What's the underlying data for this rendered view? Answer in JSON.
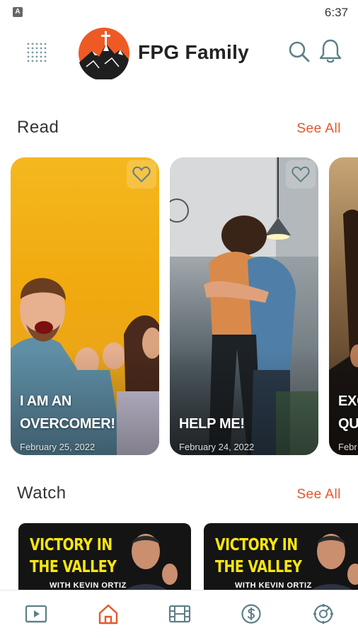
{
  "status_bar": {
    "time": "6:37",
    "indicator": "A"
  },
  "header": {
    "app_name": "FPG Family",
    "icons": [
      "grid-menu-icon",
      "search-icon",
      "bell-icon"
    ]
  },
  "read": {
    "title": "Read",
    "see_all": "See All",
    "cards": [
      {
        "title_line1": "I AM AN",
        "title_line2": "OVERCOMER!",
        "date": "February 25, 2022"
      },
      {
        "title_line1": "HELP ME!",
        "title_line2": "",
        "date": "February 24, 2022"
      },
      {
        "title_line1": "EXC",
        "title_line2": "QU",
        "date": "Febr"
      }
    ]
  },
  "watch": {
    "title": "Watch",
    "see_all": "See All",
    "videos": [
      {
        "title_line1": "VICTORY IN",
        "title_line2": "THE VALLEY",
        "subtitle": "WITH KEVIN ORTIZ"
      },
      {
        "title_line1": "VICTORY IN",
        "title_line2": "THE VALLEY",
        "subtitle": "WITH KEVIN ORTIZ"
      }
    ]
  },
  "bottom_nav": {
    "items": [
      "video-play-icon",
      "home-icon",
      "film-icon",
      "dollar-icon",
      "settings-icon"
    ],
    "active": "home-icon"
  },
  "colors": {
    "accent": "#e4572e",
    "video_title": "#f7e60f",
    "icon": "#5f7f87"
  }
}
